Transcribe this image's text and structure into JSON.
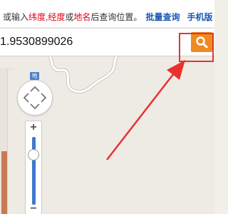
{
  "hint": {
    "prefix": "或输入",
    "lat": "纬度",
    "comma": ",",
    "lng": "经度",
    "or": "或",
    "place": "地名",
    "suffix": "后查询位置。",
    "batch_link": "批量查询",
    "mobile_link": "手机版"
  },
  "search": {
    "value": "1.9530899026",
    "button_icon": "search-icon"
  },
  "map": {
    "zoom_in_label": "+",
    "zoom_out_label": "−",
    "map_type_label": "地",
    "zoom_level_fraction": 0.28
  },
  "colors": {
    "highlight_red": "#e60012",
    "link_blue": "#1a56b5",
    "search_button": "#ef8a22",
    "annotation_red": "#e8312f",
    "zoom_track": "#3f78d0"
  }
}
